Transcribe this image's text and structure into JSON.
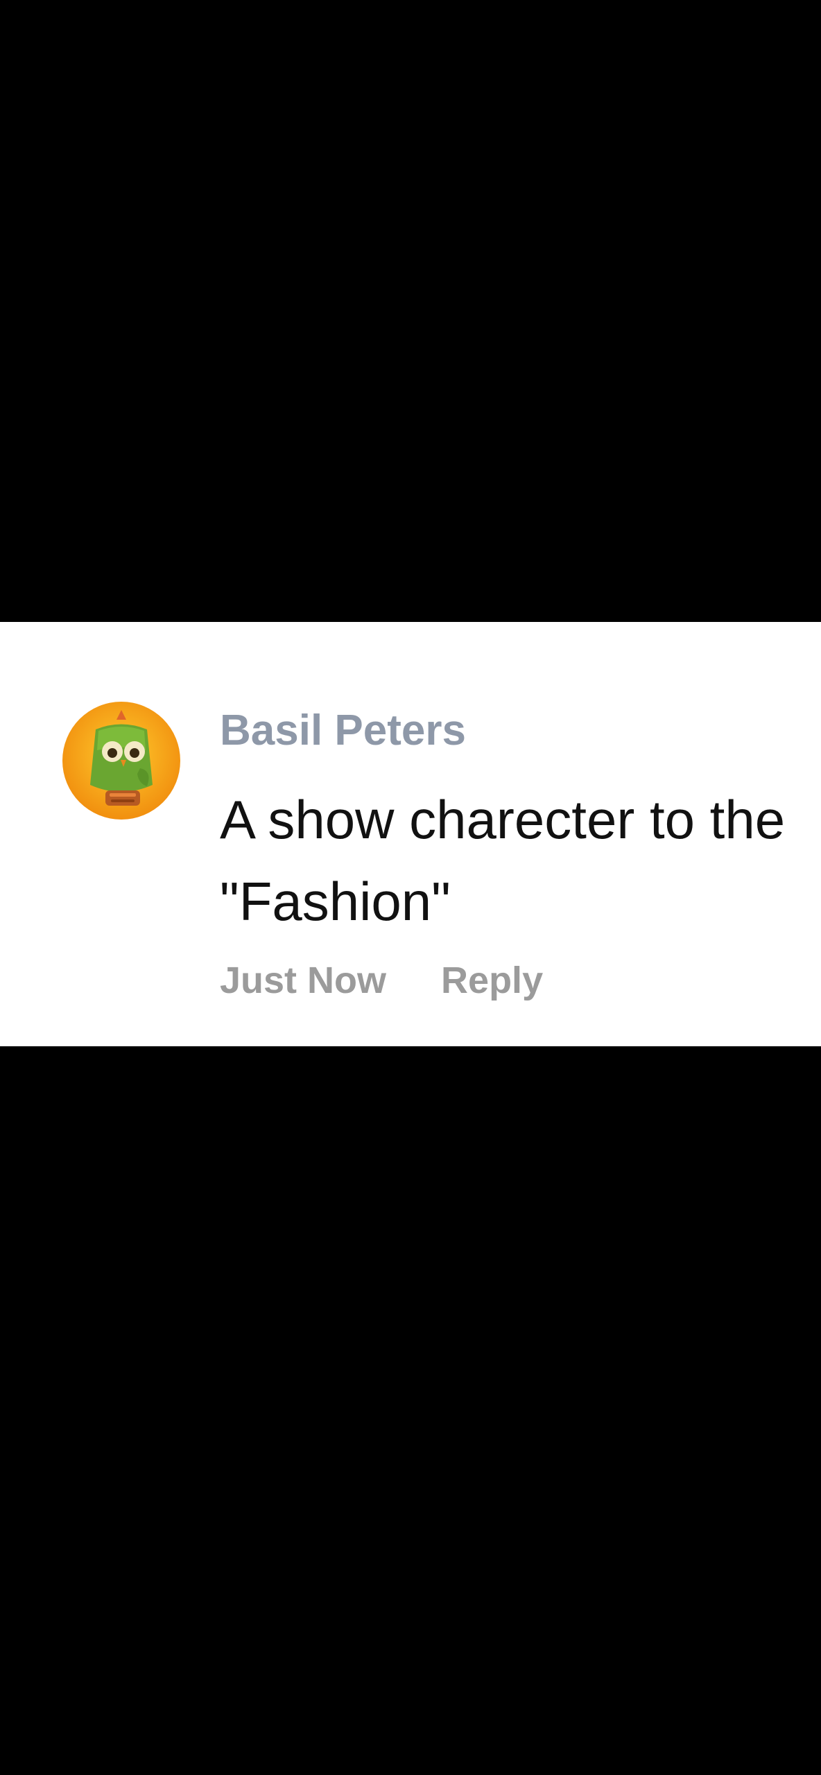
{
  "comment": {
    "author": "Basil Peters",
    "text": "A show charecter to the \"Fashion\"",
    "timestamp": "Just Now",
    "reply_label": "Reply",
    "avatar_icon": "green-owl-mascot-avatar"
  },
  "colors": {
    "background": "#000000",
    "card": "#ffffff",
    "author": "#8e98a8",
    "text": "#111111",
    "meta": "#9b9b9b",
    "avatar_bg": "#f7a21b",
    "owl_green": "#6aa631"
  }
}
